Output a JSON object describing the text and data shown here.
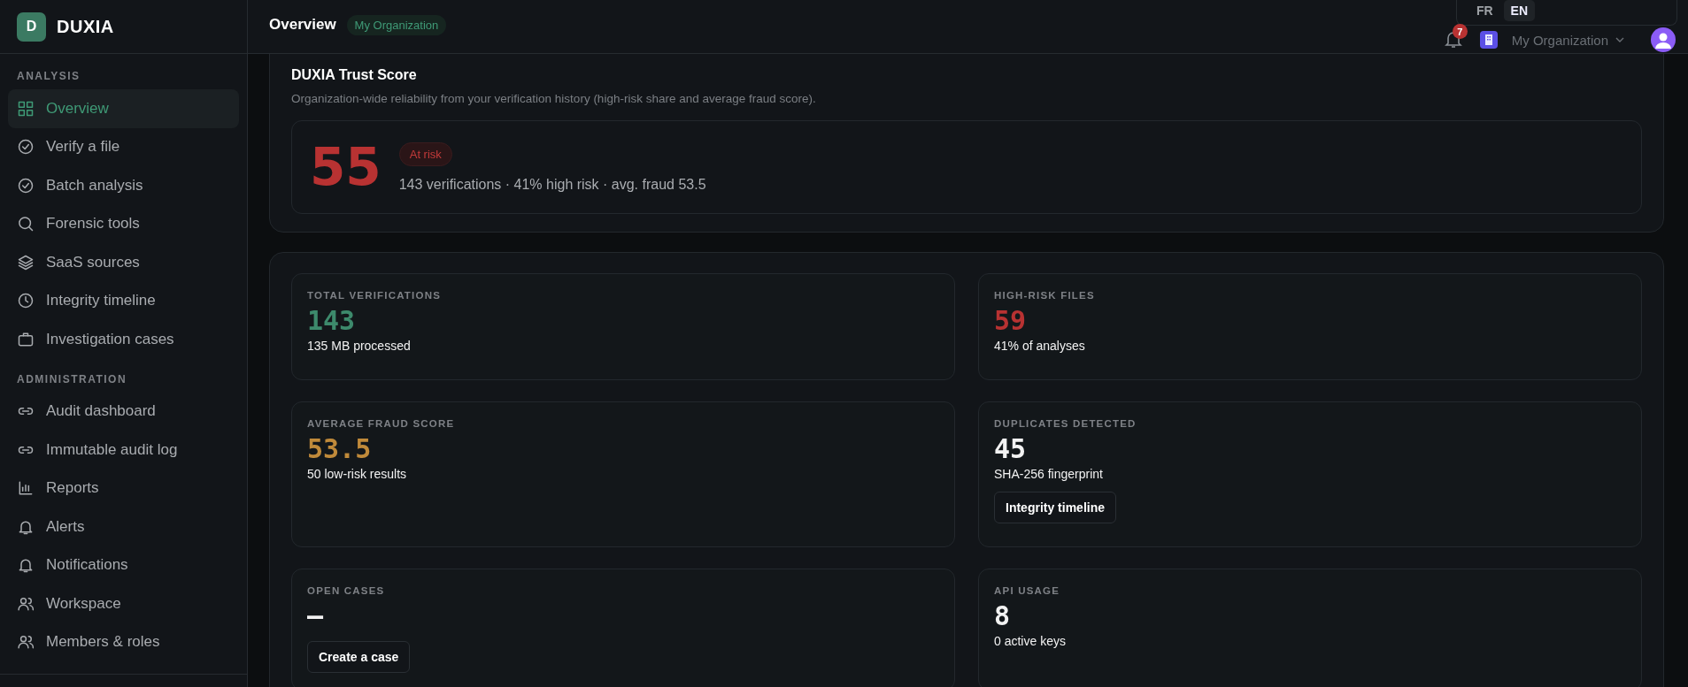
{
  "brand": {
    "logo_letter": "D",
    "name": "DUXIA"
  },
  "sidebar": {
    "sections": [
      {
        "title": "ANALYSIS",
        "items": [
          {
            "label": "Overview",
            "selected": true
          },
          {
            "label": "Verify a file",
            "selected": false
          },
          {
            "label": "Batch analysis",
            "selected": false
          },
          {
            "label": "Forensic tools",
            "selected": false
          },
          {
            "label": "SaaS sources",
            "selected": false
          },
          {
            "label": "Integrity timeline",
            "selected": false
          },
          {
            "label": "Investigation cases",
            "selected": false
          }
        ]
      },
      {
        "title": "ADMINISTRATION",
        "items": [
          {
            "label": "Audit dashboard",
            "selected": false
          },
          {
            "label": "Immutable audit log",
            "selected": false
          },
          {
            "label": "Reports",
            "selected": false
          },
          {
            "label": "Alerts",
            "selected": false
          },
          {
            "label": "Notifications",
            "selected": false
          },
          {
            "label": "Workspace",
            "selected": false
          },
          {
            "label": "Members & roles",
            "selected": false
          }
        ]
      }
    ]
  },
  "header": {
    "title": "Overview",
    "org_badge": "My Organization",
    "languages": [
      {
        "label": "FR",
        "selected": false
      },
      {
        "label": "EN",
        "selected": true
      }
    ],
    "notification_count": "7",
    "org_switcher": "My Organization"
  },
  "trust": {
    "title": "DUXIA Trust Score",
    "description": "Organization-wide reliability from your verification history (high-risk share and average fraud score).",
    "score": "55",
    "color": "#b83232",
    "status": "At risk",
    "summary": "143 verifications · 41% high risk · avg. fraud 53.5"
  },
  "stats": [
    {
      "label": "TOTAL VERIFICATIONS",
      "value": "143",
      "color": "#3d8a6c",
      "note": "135 MB processed"
    },
    {
      "label": "HIGH-RISK FILES",
      "value": "59",
      "color": "#b83232",
      "note": "41% of analyses"
    },
    {
      "label": "AVERAGE FRAUD SCORE",
      "value": "53.5",
      "color": "#c08a3a",
      "note": "50 low-risk results"
    },
    {
      "label": "DUPLICATES DETECTED",
      "value": "45",
      "color": "#f2f2f2",
      "note": "SHA-256 fingerprint",
      "action": "Integrity timeline"
    },
    {
      "label": "OPEN CASES",
      "value": "—",
      "color": "#f2f2f2",
      "action": "Create a case"
    },
    {
      "label": "API USAGE",
      "value": "8",
      "color": "#f2f2f2",
      "note": "0 active keys"
    }
  ]
}
